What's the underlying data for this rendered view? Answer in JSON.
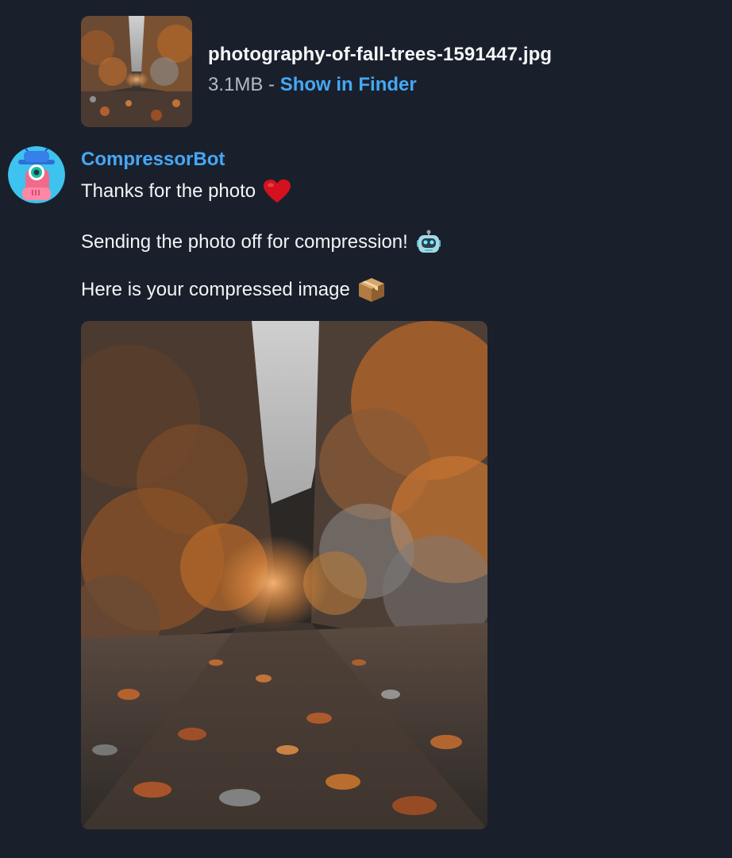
{
  "attachment": {
    "file_name": "photography-of-fall-trees-1591447.jpg",
    "file_size": "3.1MB",
    "separator": " - ",
    "action_label": "Show in Finder"
  },
  "message": {
    "sender": "CompressorBot",
    "lines": [
      "Thanks for the photo",
      "Sending the photo off for compression!",
      "Here is your compressed image"
    ],
    "emoji_icons": [
      "heart-emoji",
      "robot-emoji",
      "package-emoji"
    ]
  },
  "colors": {
    "background": "#19202b",
    "link_blue": "#46a7f5",
    "text": "#f2f4f7",
    "muted": "#b3bac5"
  }
}
